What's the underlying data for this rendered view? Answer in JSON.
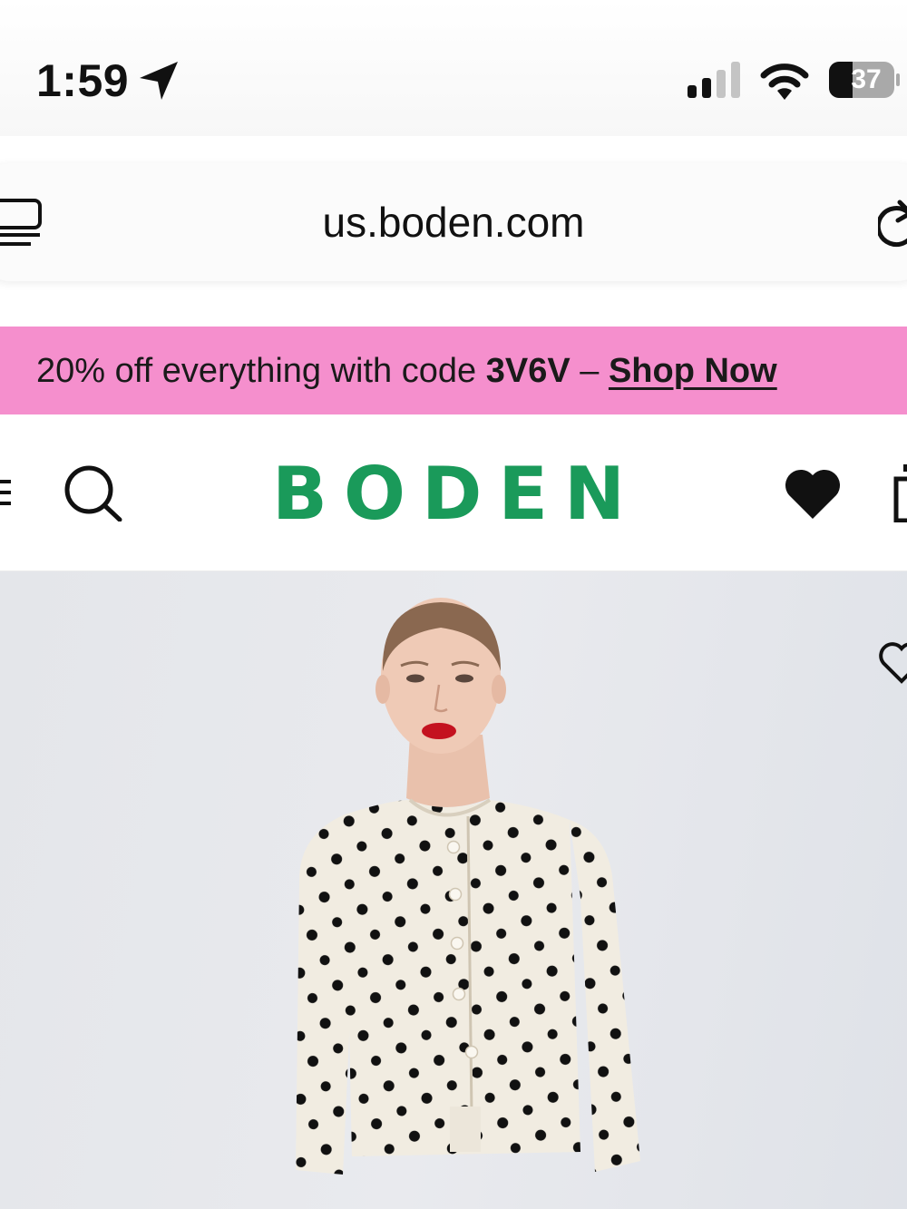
{
  "status_bar": {
    "time": "1:59",
    "battery_level": "37",
    "icons": [
      "location-arrow-icon",
      "cellular-signal-icon",
      "wifi-icon",
      "battery-icon"
    ]
  },
  "browser": {
    "url": "us.boden.com",
    "icons": [
      "tabs-icon",
      "reload-icon"
    ]
  },
  "promo": {
    "text_prefix": "20% off everything with code ",
    "code": "3V6V",
    "separator": " – ",
    "link_label": "Shop Now",
    "background_color": "#f58fcd"
  },
  "header": {
    "logo": "BODEN",
    "logo_color": "#1a9a5a",
    "icons": [
      "menu-icon",
      "search-icon",
      "heart-icon",
      "bag-icon"
    ]
  },
  "hero": {
    "icons": [
      "wishlist-heart-icon"
    ]
  }
}
